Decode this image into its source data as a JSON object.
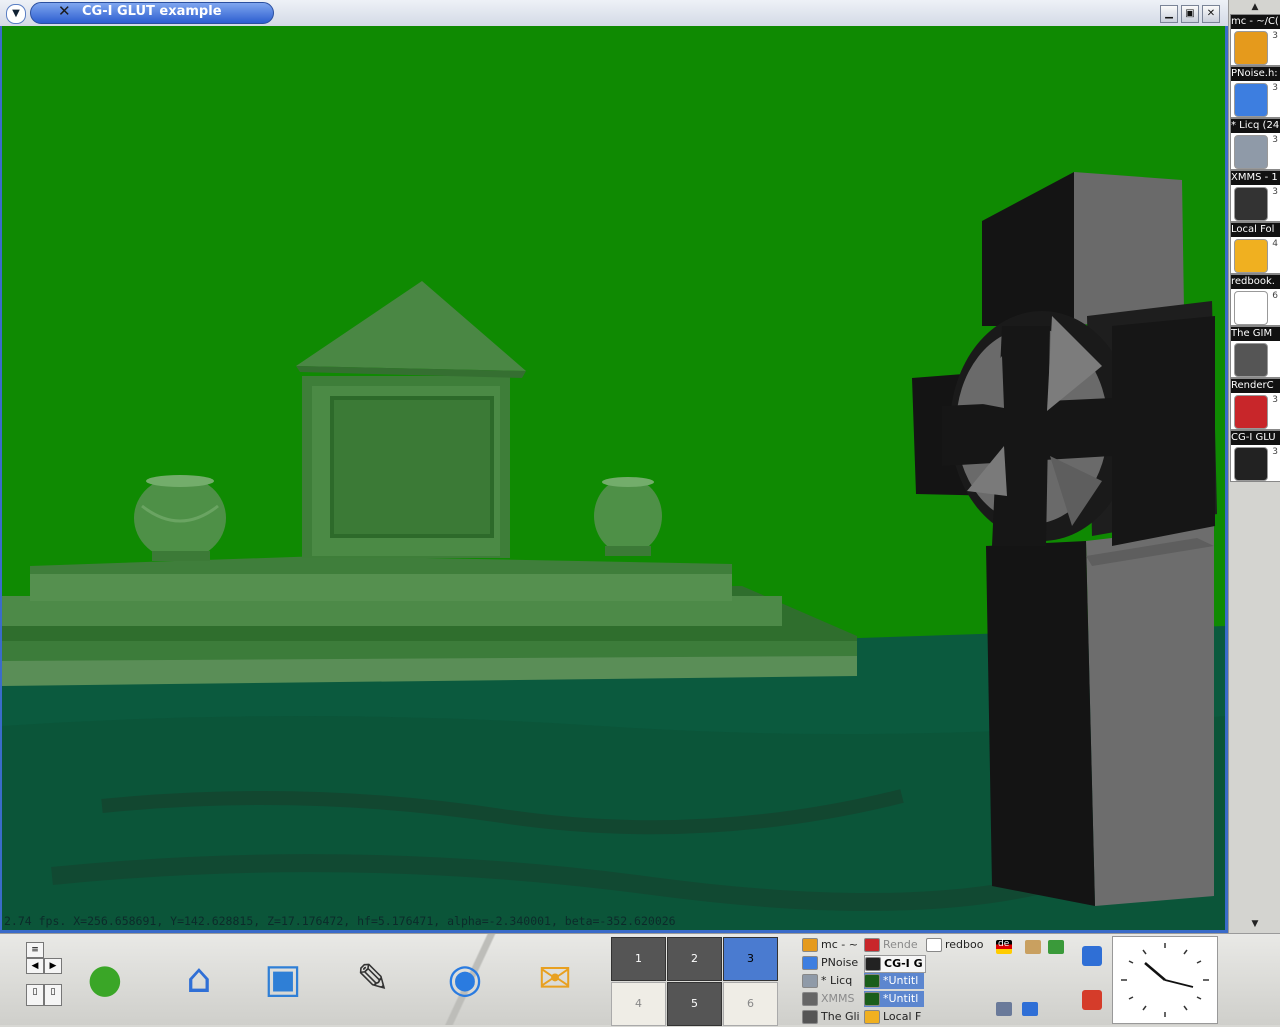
{
  "window": {
    "title": "CG-I GLUT example",
    "menu_icon": "chevron-down-icon",
    "x_icon": "x-window-icon",
    "controls": [
      "minimize-icon",
      "maximize-icon",
      "close-icon"
    ]
  },
  "status_line": "2.74 fps.  X=256.658691, Y=142.628815, Z=17.176472, hf=5.176471, alpha=-2.340001, beta=-352.620026",
  "scene": {
    "sky_color": "#0f8a02",
    "ground_color": "#0b5a3e",
    "objects": [
      "tomb-monument",
      "left-urn",
      "right-urn",
      "celtic-cross-gravestone"
    ]
  },
  "sidebar": {
    "items": [
      {
        "label": "mc - ~/C(",
        "num": "3",
        "color": "#e59a1c"
      },
      {
        "label": "PNoise.h:",
        "num": "3",
        "color": "#3d7ee0"
      },
      {
        "label": "* Licq (24",
        "num": "3",
        "color": "#8f9aa8"
      },
      {
        "label": "XMMS - 1",
        "num": "3",
        "color": "#333333"
      },
      {
        "label": "Local Fol",
        "num": "4",
        "color": "#f0b020"
      },
      {
        "label": "redbook.",
        "num": "6",
        "color": "#ffffff"
      },
      {
        "label": "The GIM",
        "num": "",
        "color": "#555555"
      },
      {
        "label": "RenderC",
        "num": "3",
        "color": "#c8262a"
      },
      {
        "label": "CG-I GLU",
        "num": "3",
        "color": "#222222"
      }
    ]
  },
  "panel": {
    "launchers": [
      {
        "name": "suse-menu-icon",
        "glyph": "●",
        "color": "#3aa627"
      },
      {
        "name": "home-folder-icon",
        "glyph": "⌂",
        "color": "#2f6fd6"
      },
      {
        "name": "desktop-preview-icon",
        "glyph": "▣",
        "color": "#2f7fd6"
      },
      {
        "name": "kate-editor-icon",
        "glyph": "✎",
        "color": "#333333"
      },
      {
        "name": "konqueror-browser-icon",
        "glyph": "◉",
        "color": "#2a7be0"
      },
      {
        "name": "kmail-icon",
        "glyph": "✉",
        "color": "#e8a020"
      }
    ],
    "desktops": [
      {
        "label": "1",
        "style": "dark"
      },
      {
        "label": "2",
        "style": "dark"
      },
      {
        "label": "3",
        "style": "active"
      },
      {
        "label": "4",
        "style": "light"
      },
      {
        "label": "5",
        "style": "dark"
      },
      {
        "label": "6",
        "style": "light"
      }
    ],
    "tasks": [
      {
        "label": "mc - ~",
        "style": "",
        "color": "#e59a1c"
      },
      {
        "label": "PNoise",
        "style": "",
        "color": "#3d7ee0"
      },
      {
        "label": "* Licq",
        "style": "",
        "color": "#8f9aa8"
      },
      {
        "label": "XMMS",
        "style": "dim",
        "color": "#666666"
      },
      {
        "label": "The Gli",
        "style": "",
        "color": "#555555"
      },
      {
        "label": "Rende",
        "style": "dim",
        "color": "#c8262a"
      },
      {
        "label": "CG-I G",
        "style": "active",
        "color": "#222222"
      },
      {
        "label": "*Untitl",
        "style": "hl",
        "color": "#1a5e1a"
      },
      {
        "label": "*Untitl",
        "style": "hl",
        "color": "#1a5e1a"
      },
      {
        "label": "Local F",
        "style": "",
        "color": "#f0b020"
      },
      {
        "label": "redboo",
        "style": "",
        "color": "#ffffff"
      }
    ],
    "tray": {
      "keyboard_layout": "de",
      "items": [
        "flag-de-icon",
        "clipboard-icon",
        "network-icon",
        "printer-icon",
        "volume-icon"
      ]
    }
  }
}
